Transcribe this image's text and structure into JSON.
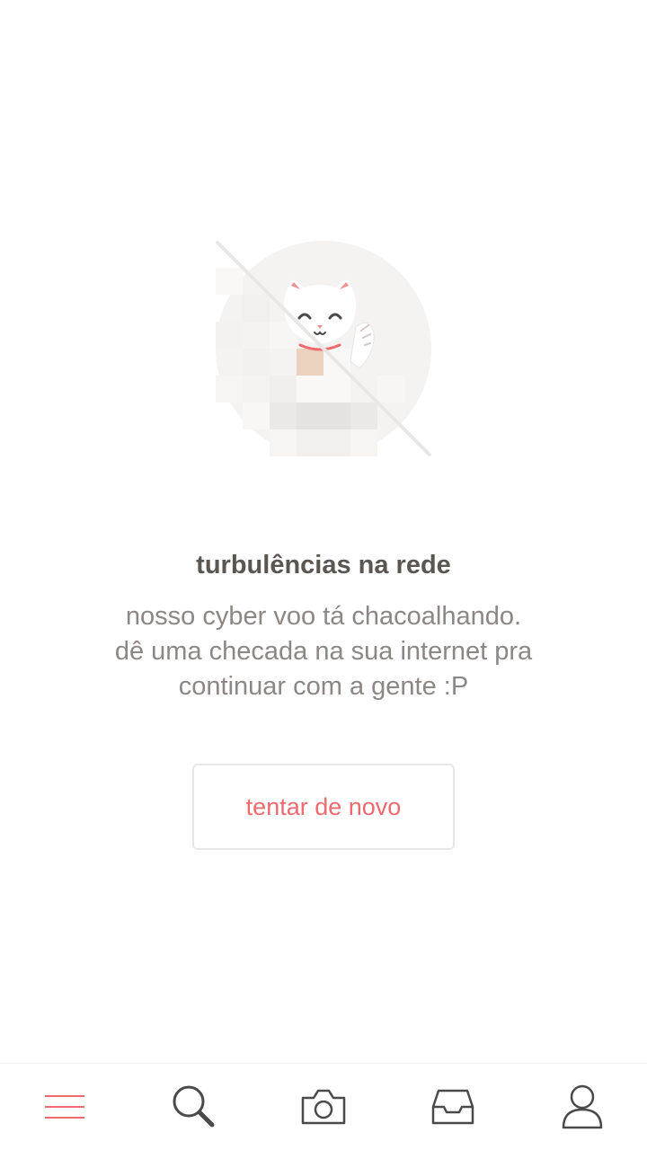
{
  "error": {
    "title": "turbulências na rede",
    "message_lines": [
      "nosso cyber voo tá chacoalhando.",
      "dê uma checada na sua internet pra",
      "continuar com a gente :P"
    ],
    "retry_label": "tentar de novo",
    "illustration": "lucky-cat-offline-illustration"
  },
  "bottom_nav": {
    "items": [
      {
        "icon": "menu-icon",
        "active": true
      },
      {
        "icon": "search-icon",
        "active": false
      },
      {
        "icon": "camera-icon",
        "active": false
      },
      {
        "icon": "inbox-icon",
        "active": false
      },
      {
        "icon": "profile-icon",
        "active": false
      }
    ]
  },
  "colors": {
    "accent": "#ef6a6e",
    "title": "#5c5653",
    "text": "#8c8785",
    "icon": "#4a4a4a",
    "border": "#e9e7e6"
  }
}
